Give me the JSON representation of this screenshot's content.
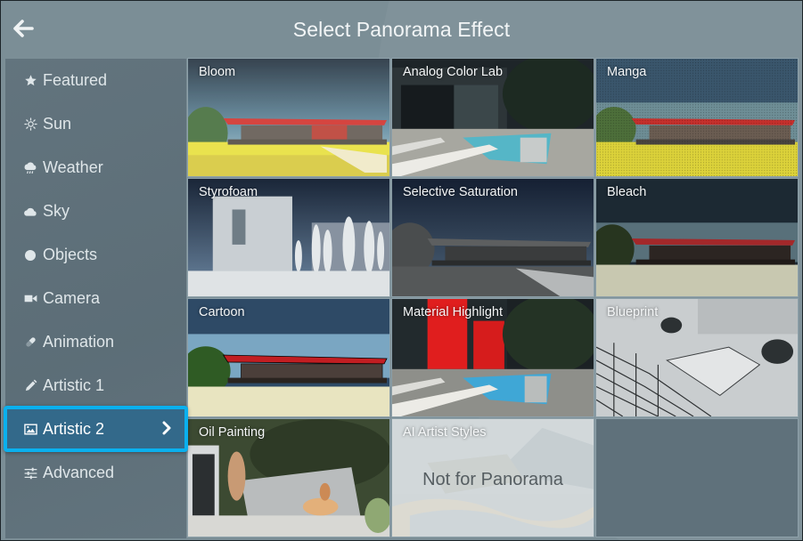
{
  "header": {
    "title": "Select Panorama Effect",
    "back_icon": "arrow-left-icon"
  },
  "sidebar": {
    "items": [
      {
        "label": "Featured",
        "icon": "star-icon",
        "active": false
      },
      {
        "label": "Sun",
        "icon": "sun-icon",
        "active": false
      },
      {
        "label": "Weather",
        "icon": "cloud-rain-icon",
        "active": false
      },
      {
        "label": "Sky",
        "icon": "cloud-icon",
        "active": false
      },
      {
        "label": "Objects",
        "icon": "circle-icon",
        "active": false
      },
      {
        "label": "Camera",
        "icon": "video-camera-icon",
        "active": false
      },
      {
        "label": "Animation",
        "icon": "pill-icon",
        "active": false
      },
      {
        "label": "Artistic 1",
        "icon": "pencil-icon",
        "active": false
      },
      {
        "label": "Artistic 2",
        "icon": "image-icon",
        "active": true
      },
      {
        "label": "Advanced",
        "icon": "sliders-icon",
        "active": false
      }
    ],
    "active_chevron_icon": "chevron-right-icon"
  },
  "effects": [
    {
      "label": "Bloom",
      "thumbnail": "house-bloom"
    },
    {
      "label": "Analog Color Lab",
      "thumbnail": "pool-analog"
    },
    {
      "label": "Manga",
      "thumbnail": "house-manga"
    },
    {
      "label": "Styrofoam",
      "thumbnail": "building-styrofoam"
    },
    {
      "label": "Selective Saturation",
      "thumbnail": "house-gray"
    },
    {
      "label": "Bleach",
      "thumbnail": "house-bleach"
    },
    {
      "label": "Cartoon",
      "thumbnail": "house-cartoon"
    },
    {
      "label": "Material Highlight",
      "thumbnail": "pool-red"
    },
    {
      "label": "Blueprint",
      "thumbnail": "bedroom-lines"
    },
    {
      "label": "Oil Painting",
      "thumbnail": "oil-painting"
    },
    {
      "label": "AI Artist Styles",
      "thumbnail": "ai-painting",
      "disabled": true,
      "disabled_message": "Not for Panorama"
    }
  ],
  "colors": {
    "header_bg": "#7b8e96",
    "sidebar_bg": "#5f717b",
    "active_bg": "#33698a",
    "active_border": "#0ab0ee",
    "text": "#dfe6e9"
  }
}
